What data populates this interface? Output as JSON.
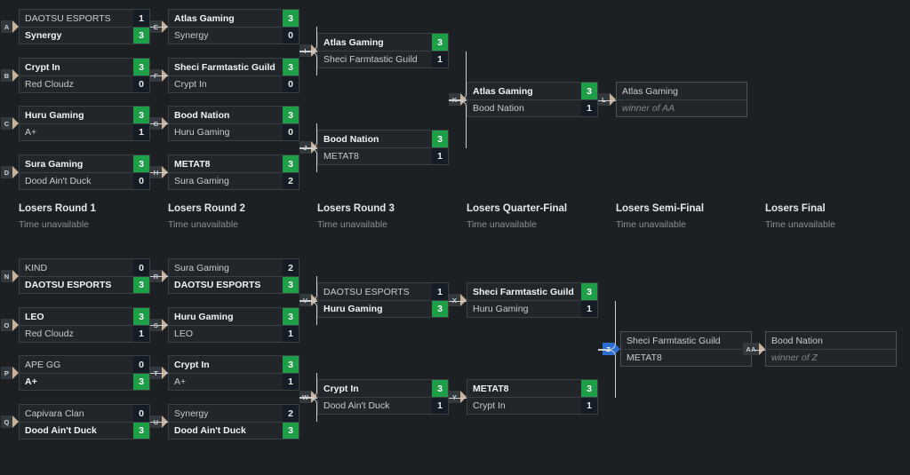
{
  "background_color": "#1d2023",
  "accent_win_color": "#1f9e48",
  "accent_active_color": "#2a6ed1",
  "rounds": [
    {
      "title": "Losers Round 1",
      "time": "Time unavailable"
    },
    {
      "title": "Losers Round 2",
      "time": "Time unavailable"
    },
    {
      "title": "Losers Round 3",
      "time": "Time unavailable"
    },
    {
      "title": "Losers Quarter-Final",
      "time": "Time unavailable"
    },
    {
      "title": "Losers Semi-Final",
      "time": "Time unavailable"
    },
    {
      "title": "Losers Final",
      "time": "Time unavailable"
    }
  ],
  "winners": [
    {
      "code": "A",
      "top": {
        "name": "DAOTSU ESPORTS",
        "score": "1",
        "winner": false
      },
      "bottom": {
        "name": "Synergy",
        "score": "3",
        "winner": true
      }
    },
    {
      "code": "B",
      "top": {
        "name": "Crypt In",
        "score": "3",
        "winner": true
      },
      "bottom": {
        "name": "Red Cloudz",
        "score": "0",
        "winner": false
      }
    },
    {
      "code": "C",
      "top": {
        "name": "Huru Gaming",
        "score": "3",
        "winner": true
      },
      "bottom": {
        "name": "A+",
        "score": "1",
        "winner": false
      }
    },
    {
      "code": "D",
      "top": {
        "name": "Sura Gaming",
        "score": "3",
        "winner": true
      },
      "bottom": {
        "name": "Dood Ain't Duck",
        "score": "0",
        "winner": false
      }
    },
    {
      "code": "E",
      "top": {
        "name": "Atlas Gaming",
        "score": "3",
        "winner": true
      },
      "bottom": {
        "name": "Synergy",
        "score": "0",
        "winner": false
      }
    },
    {
      "code": "F",
      "top": {
        "name": "Sheci Farmtastic Guild",
        "score": "3",
        "winner": true
      },
      "bottom": {
        "name": "Crypt In",
        "score": "0",
        "winner": false
      }
    },
    {
      "code": "G",
      "top": {
        "name": "Bood Nation",
        "score": "3",
        "winner": true
      },
      "bottom": {
        "name": "Huru Gaming",
        "score": "0",
        "winner": false
      }
    },
    {
      "code": "H",
      "top": {
        "name": "METAT8",
        "score": "3",
        "winner": true
      },
      "bottom": {
        "name": "Sura Gaming",
        "score": "2",
        "winner": false
      }
    },
    {
      "code": "I",
      "top": {
        "name": "Atlas Gaming",
        "score": "3",
        "winner": true
      },
      "bottom": {
        "name": "Sheci Farmtastic Guild",
        "score": "1",
        "winner": false
      }
    },
    {
      "code": "J",
      "top": {
        "name": "Bood Nation",
        "score": "3",
        "winner": true
      },
      "bottom": {
        "name": "METAT8",
        "score": "1",
        "winner": false
      }
    },
    {
      "code": "K",
      "top": {
        "name": "Atlas Gaming",
        "score": "3",
        "winner": true
      },
      "bottom": {
        "name": "Bood Nation",
        "score": "1",
        "winner": false
      }
    },
    {
      "code": "L",
      "top": {
        "name": "Atlas Gaming",
        "score": "",
        "winner": false
      },
      "bottom": {
        "name": "winner of AA",
        "score": "",
        "winner": false,
        "placeholder": true
      }
    }
  ],
  "losers": [
    {
      "code": "N",
      "top": {
        "name": "KIND",
        "score": "0",
        "winner": false
      },
      "bottom": {
        "name": "DAOTSU ESPORTS",
        "score": "3",
        "winner": true
      }
    },
    {
      "code": "O",
      "top": {
        "name": "LEO",
        "score": "3",
        "winner": true
      },
      "bottom": {
        "name": "Red Cloudz",
        "score": "1",
        "winner": false
      }
    },
    {
      "code": "P",
      "top": {
        "name": "APE GG",
        "score": "0",
        "winner": false
      },
      "bottom": {
        "name": "A+",
        "score": "3",
        "winner": true
      }
    },
    {
      "code": "Q",
      "top": {
        "name": "Capivara Clan",
        "score": "0",
        "winner": false
      },
      "bottom": {
        "name": "Dood Ain't Duck",
        "score": "3",
        "winner": true
      }
    },
    {
      "code": "R",
      "top": {
        "name": "Sura Gaming",
        "score": "2",
        "winner": false
      },
      "bottom": {
        "name": "DAOTSU ESPORTS",
        "score": "3",
        "winner": true
      }
    },
    {
      "code": "S",
      "top": {
        "name": "Huru Gaming",
        "score": "3",
        "winner": true
      },
      "bottom": {
        "name": "LEO",
        "score": "1",
        "winner": false
      }
    },
    {
      "code": "T",
      "top": {
        "name": "Crypt In",
        "score": "3",
        "winner": true
      },
      "bottom": {
        "name": "A+",
        "score": "1",
        "winner": false
      }
    },
    {
      "code": "U",
      "top": {
        "name": "Synergy",
        "score": "2",
        "winner": false
      },
      "bottom": {
        "name": "Dood Ain't Duck",
        "score": "3",
        "winner": true
      }
    },
    {
      "code": "V",
      "top": {
        "name": "DAOTSU ESPORTS",
        "score": "1",
        "winner": false
      },
      "bottom": {
        "name": "Huru Gaming",
        "score": "3",
        "winner": true
      }
    },
    {
      "code": "W",
      "top": {
        "name": "Crypt In",
        "score": "3",
        "winner": true
      },
      "bottom": {
        "name": "Dood Ain't Duck",
        "score": "1",
        "winner": false
      }
    },
    {
      "code": "X",
      "top": {
        "name": "Sheci Farmtastic Guild",
        "score": "3",
        "winner": true
      },
      "bottom": {
        "name": "Huru Gaming",
        "score": "1",
        "winner": false
      }
    },
    {
      "code": "Y",
      "top": {
        "name": "METAT8",
        "score": "3",
        "winner": true
      },
      "bottom": {
        "name": "Crypt In",
        "score": "1",
        "winner": false
      }
    },
    {
      "code": "Z",
      "top": {
        "name": "Sheci Farmtastic Guild",
        "score": "",
        "winner": false
      },
      "bottom": {
        "name": "METAT8",
        "score": "",
        "winner": false
      }
    },
    {
      "code": "AA",
      "top": {
        "name": "Bood Nation",
        "score": "",
        "winner": false
      },
      "bottom": {
        "name": "winner of Z",
        "score": "",
        "winner": false,
        "placeholder": true
      }
    }
  ]
}
